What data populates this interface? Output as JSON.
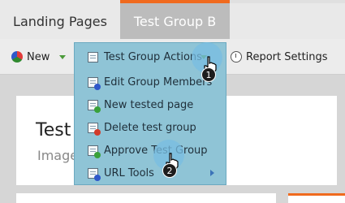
{
  "tabs": [
    {
      "label": "Landing Pages"
    },
    {
      "label": "Test Group B"
    }
  ],
  "toolbar": {
    "new_label": "New",
    "report_label": "Report Settings"
  },
  "content": {
    "title": "Test",
    "subtitle": "Image"
  },
  "menu": {
    "items": [
      {
        "label": "Test Group Actions"
      },
      {
        "label": "Edit Group Members"
      },
      {
        "label": "New tested page"
      },
      {
        "label": "Delete test group"
      },
      {
        "label": "Approve Test Group"
      },
      {
        "label": "URL Tools"
      }
    ]
  },
  "steps": [
    "1",
    "2"
  ],
  "colors": {
    "accent": "#f06a1e",
    "menu_bg": "#8fc4d6",
    "highlight": "#78bee1"
  }
}
